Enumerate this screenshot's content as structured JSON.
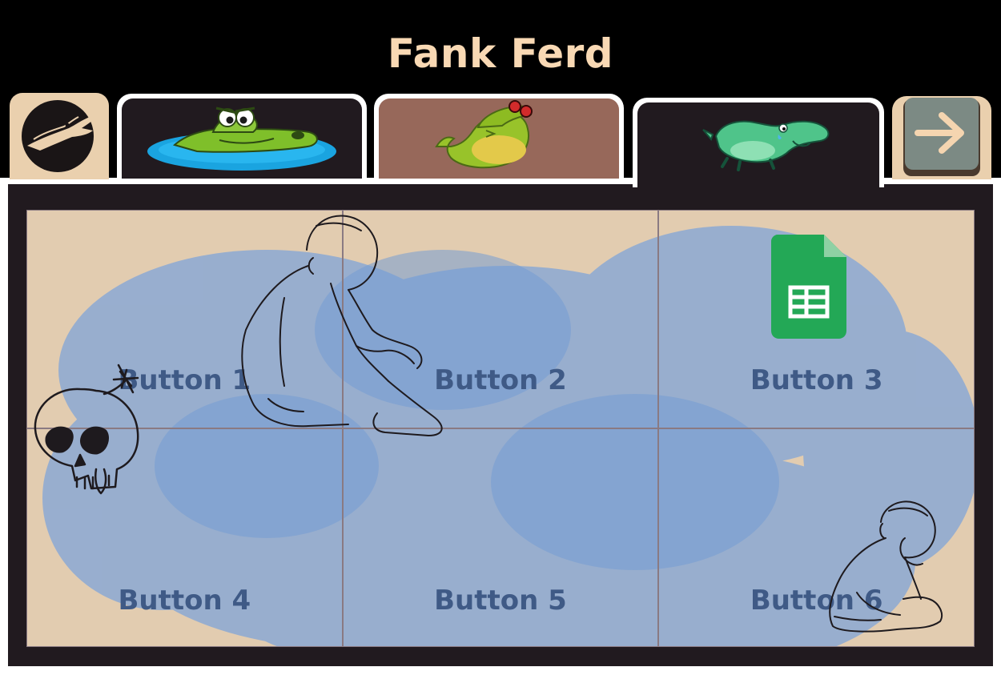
{
  "header": {
    "title": "Fank Ferd"
  },
  "tabs": [
    {
      "id": "home",
      "icon": "crocodile-silhouette-icon"
    },
    {
      "id": "tab-1",
      "icon": "crocodile-in-water-icon"
    },
    {
      "id": "tab-2",
      "icon": "crocodile-sunglasses-icon"
    },
    {
      "id": "tab-3",
      "icon": "crying-crocodile-icon",
      "selected": true
    },
    {
      "id": "next",
      "icon": "arrow-right-icon"
    }
  ],
  "buttons": [
    {
      "label": "Button 1"
    },
    {
      "label": "Button 2"
    },
    {
      "label": "Button 3",
      "icon": "google-sheets-icon"
    },
    {
      "label": "Button 4"
    },
    {
      "label": "Button 5"
    },
    {
      "label": "Button 6"
    }
  ],
  "colors": {
    "header_bg": "#000000",
    "title": "#f9d9b4",
    "tab_beige": "#ead0ae",
    "tab_dark": "#211a1f",
    "tab_brown": "#97685a",
    "button_text": "#3f5a86",
    "wash_blue": "#7aa3dc",
    "sheets_green": "#23a856"
  }
}
